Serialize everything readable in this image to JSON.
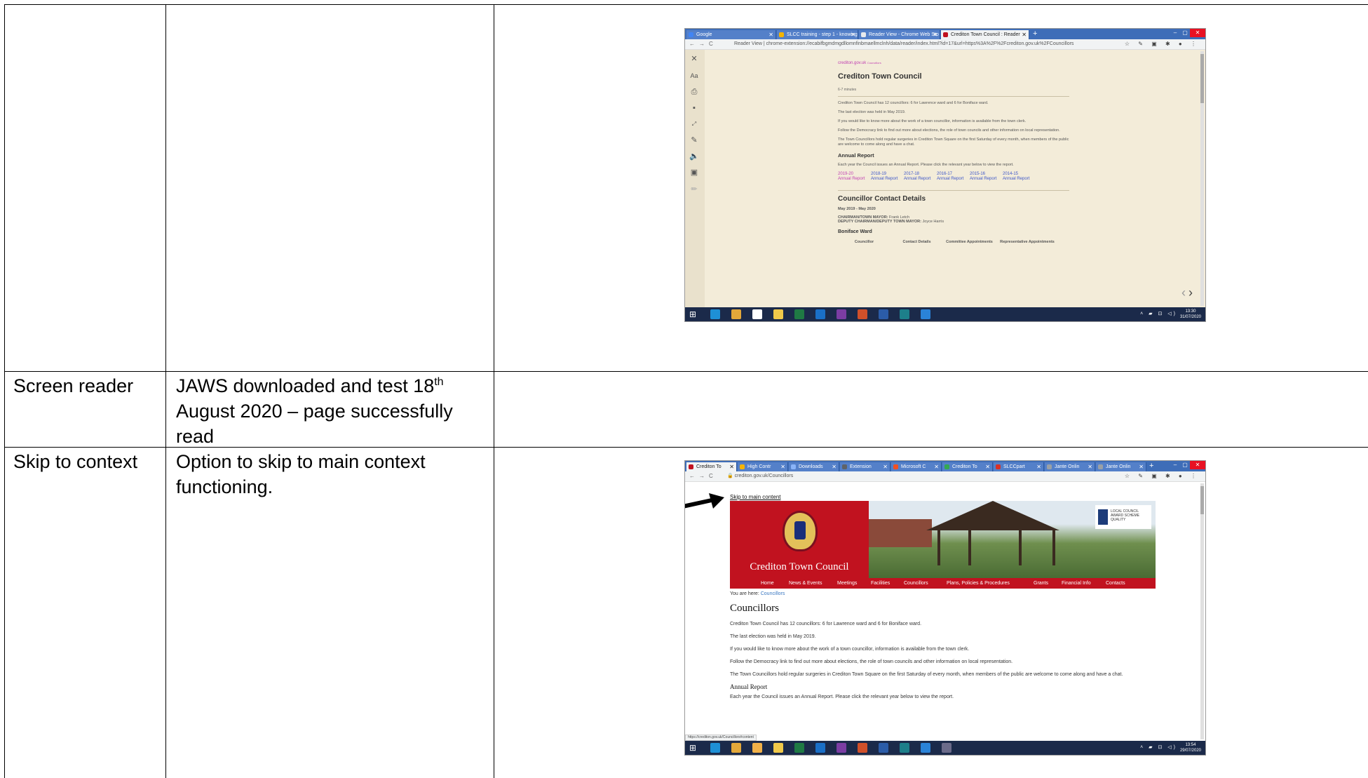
{
  "rows": [
    {
      "feature": "",
      "description": ""
    },
    {
      "feature": "Screen reader",
      "description_main": "JAWS downloaded and test 18",
      "description_sup": "th",
      "description_rest": "August 2020 – page successfully read"
    },
    {
      "feature": "Skip to context",
      "description": "Option to skip to main context functioning."
    }
  ],
  "shot1": {
    "tabs": [
      "Google",
      "SLCC training - step 1 - knowing",
      "Reader View - Chrome Web Sto",
      "Crediton Town Council : Reader"
    ],
    "url": "Reader View | chrome-extension://ecabifbgmdmgdllomnfinbmaellmclnh/data/reader/index.html?id=17&url=https%3A%2F%2Fcrediton.gov.uk%2FCouncillors",
    "domain": "crediton.gov.uk",
    "domain_suffix": "Councillors",
    "title": "Crediton Town Council",
    "read_time": "6-7 minutes",
    "paragraphs": [
      "Crediton Town Council has 12 councillors: 6 for Lawrence ward and 6 for Boniface ward.",
      "The last election was held in May 2019.",
      "If you would like to know more about the work of a town councillor, information is available from the town clerk.",
      "Follow the Democracy link to find out more about elections, the role of town councils and other information on local representation.",
      "The Town Councillors hold regular surgeries in Crediton Town Square on the first Saturday of every month, when members of the public are welcome to come along and have a chat."
    ],
    "annual_report_heading": "Annual Report",
    "annual_report_text": "Each year the Council issues an Annual Report. Please click the relevant year below to view the report.",
    "report_years": [
      "2019-20",
      "2018-19",
      "2017-18",
      "2016-17",
      "2015-16",
      "2014-15"
    ],
    "report_label": "Annual Report",
    "contact_heading": "Councillor Contact Details",
    "term": "May 2019 - May 2020",
    "chairman_label": "CHAIRMAN/TOWN MAYOR:",
    "chairman": "Frank Letch",
    "deputy_label": "DEPUTY CHAIRMAN/DEPUTY TOWN MAYOR:",
    "deputy": "Joyce Harris",
    "ward_heading": "Boniface Ward",
    "table_headers": [
      "Councillor",
      "Contact Details",
      "Committee Appointments",
      "Representative Appointments"
    ],
    "clock_time": "13:30",
    "clock_date": "31/07/2020"
  },
  "shot2": {
    "tabs": [
      "Crediton To",
      "High Contr",
      "Downloads",
      "Extension",
      "Microsoft C",
      "Crediton To",
      "SLCCpart",
      "Jante Onlin",
      "Jante Onlin"
    ],
    "url": "crediton.gov.uk/Councillors",
    "skip_link": "Skip to main content",
    "site_name": "Crediton Town Council",
    "award_text": "LOCAL COUNCIL AWARD SCHEME QUALITY",
    "nav": [
      "Home",
      "News & Events",
      "Meetings",
      "Facilities",
      "Councillors",
      "Plans, Policies & Procedures",
      "Grants",
      "Financial Info",
      "Contacts"
    ],
    "breadcrumb_label": "You are here:",
    "breadcrumb_link": "Councillors",
    "page_title": "Councillors",
    "paragraphs": [
      "Crediton Town Council has 12 councillors: 6 for Lawrence ward and 6 for Boniface ward.",
      "The last election was held in May 2019.",
      "If you would like to know more about the work of a town councillor, information is available from the town clerk.",
      "Follow the Democracy link to find out more about elections, the role of town councils and other information on local representation.",
      "The Town Councillors hold regular surgeries in Crediton Town Square on the first Saturday of every month, when members of the public are welcome to come along and have a chat."
    ],
    "annual_report_heading": "Annual Report",
    "annual_report_text": "Each year the Council issues an Annual Report. Please click the relevant year below to view the report.",
    "status_url": "https://crediton.gov.uk/Councillors#content",
    "clock_time": "13:54",
    "clock_date": "29/07/2020"
  },
  "colors": {
    "reader_bg": "#f3ecd9",
    "brand_red": "#c1121f",
    "chrome_blue": "#3e6db8",
    "link_blue": "#3d56c9",
    "link_pink": "#c03fb2"
  }
}
